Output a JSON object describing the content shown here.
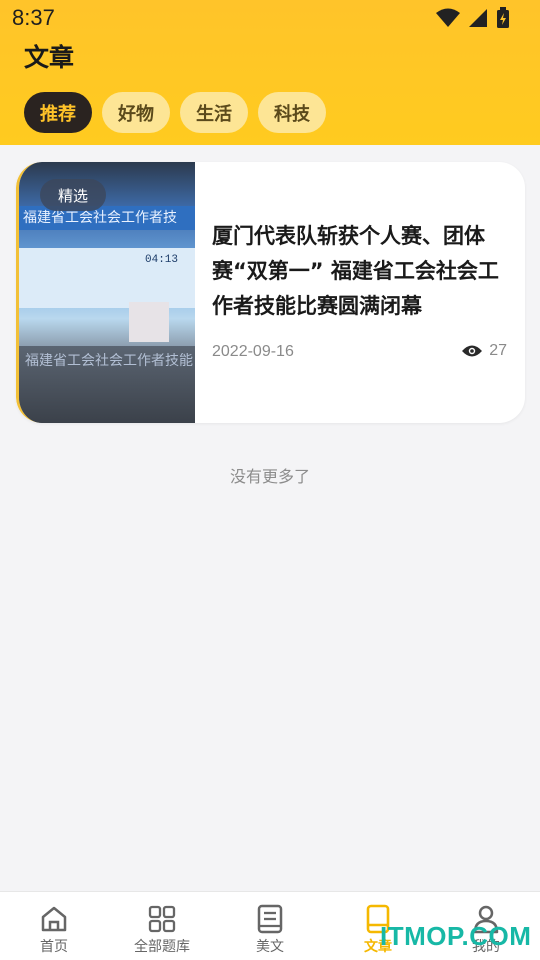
{
  "status_bar": {
    "time": "8:37"
  },
  "header": {
    "title": "文章"
  },
  "tabs": [
    {
      "label": "推荐",
      "active": true
    },
    {
      "label": "好物",
      "active": false
    },
    {
      "label": "生活",
      "active": false
    },
    {
      "label": "科技",
      "active": false
    }
  ],
  "article": {
    "badge": "精选",
    "thumb_banner_text": "福建省工会社会工作者技",
    "thumb_lower_text": "福建省工会社会工作者技能",
    "thumb_screen_text": "04:13",
    "title": "厦门代表队斩获个人赛、团体赛“双第一” 福建省工会社会工作者技能比赛圆满闭幕",
    "date": "2022-09-16",
    "views": "27"
  },
  "list_footer": "没有更多了",
  "tabbar": {
    "items": [
      {
        "label": "首页",
        "icon": "home-icon",
        "active": false
      },
      {
        "label": "全部题库",
        "icon": "grid-icon",
        "active": false
      },
      {
        "label": "美文",
        "icon": "book-icon",
        "active": false
      },
      {
        "label": "文章",
        "icon": "bookmark-icon",
        "active": true
      },
      {
        "label": "我的",
        "icon": "user-icon",
        "active": false
      }
    ]
  },
  "watermark": "ITMOP.COM",
  "colors": {
    "accent": "#ffc42a",
    "active_tab_text": "#ffc329",
    "active_tab_bg": "#2a2320"
  }
}
